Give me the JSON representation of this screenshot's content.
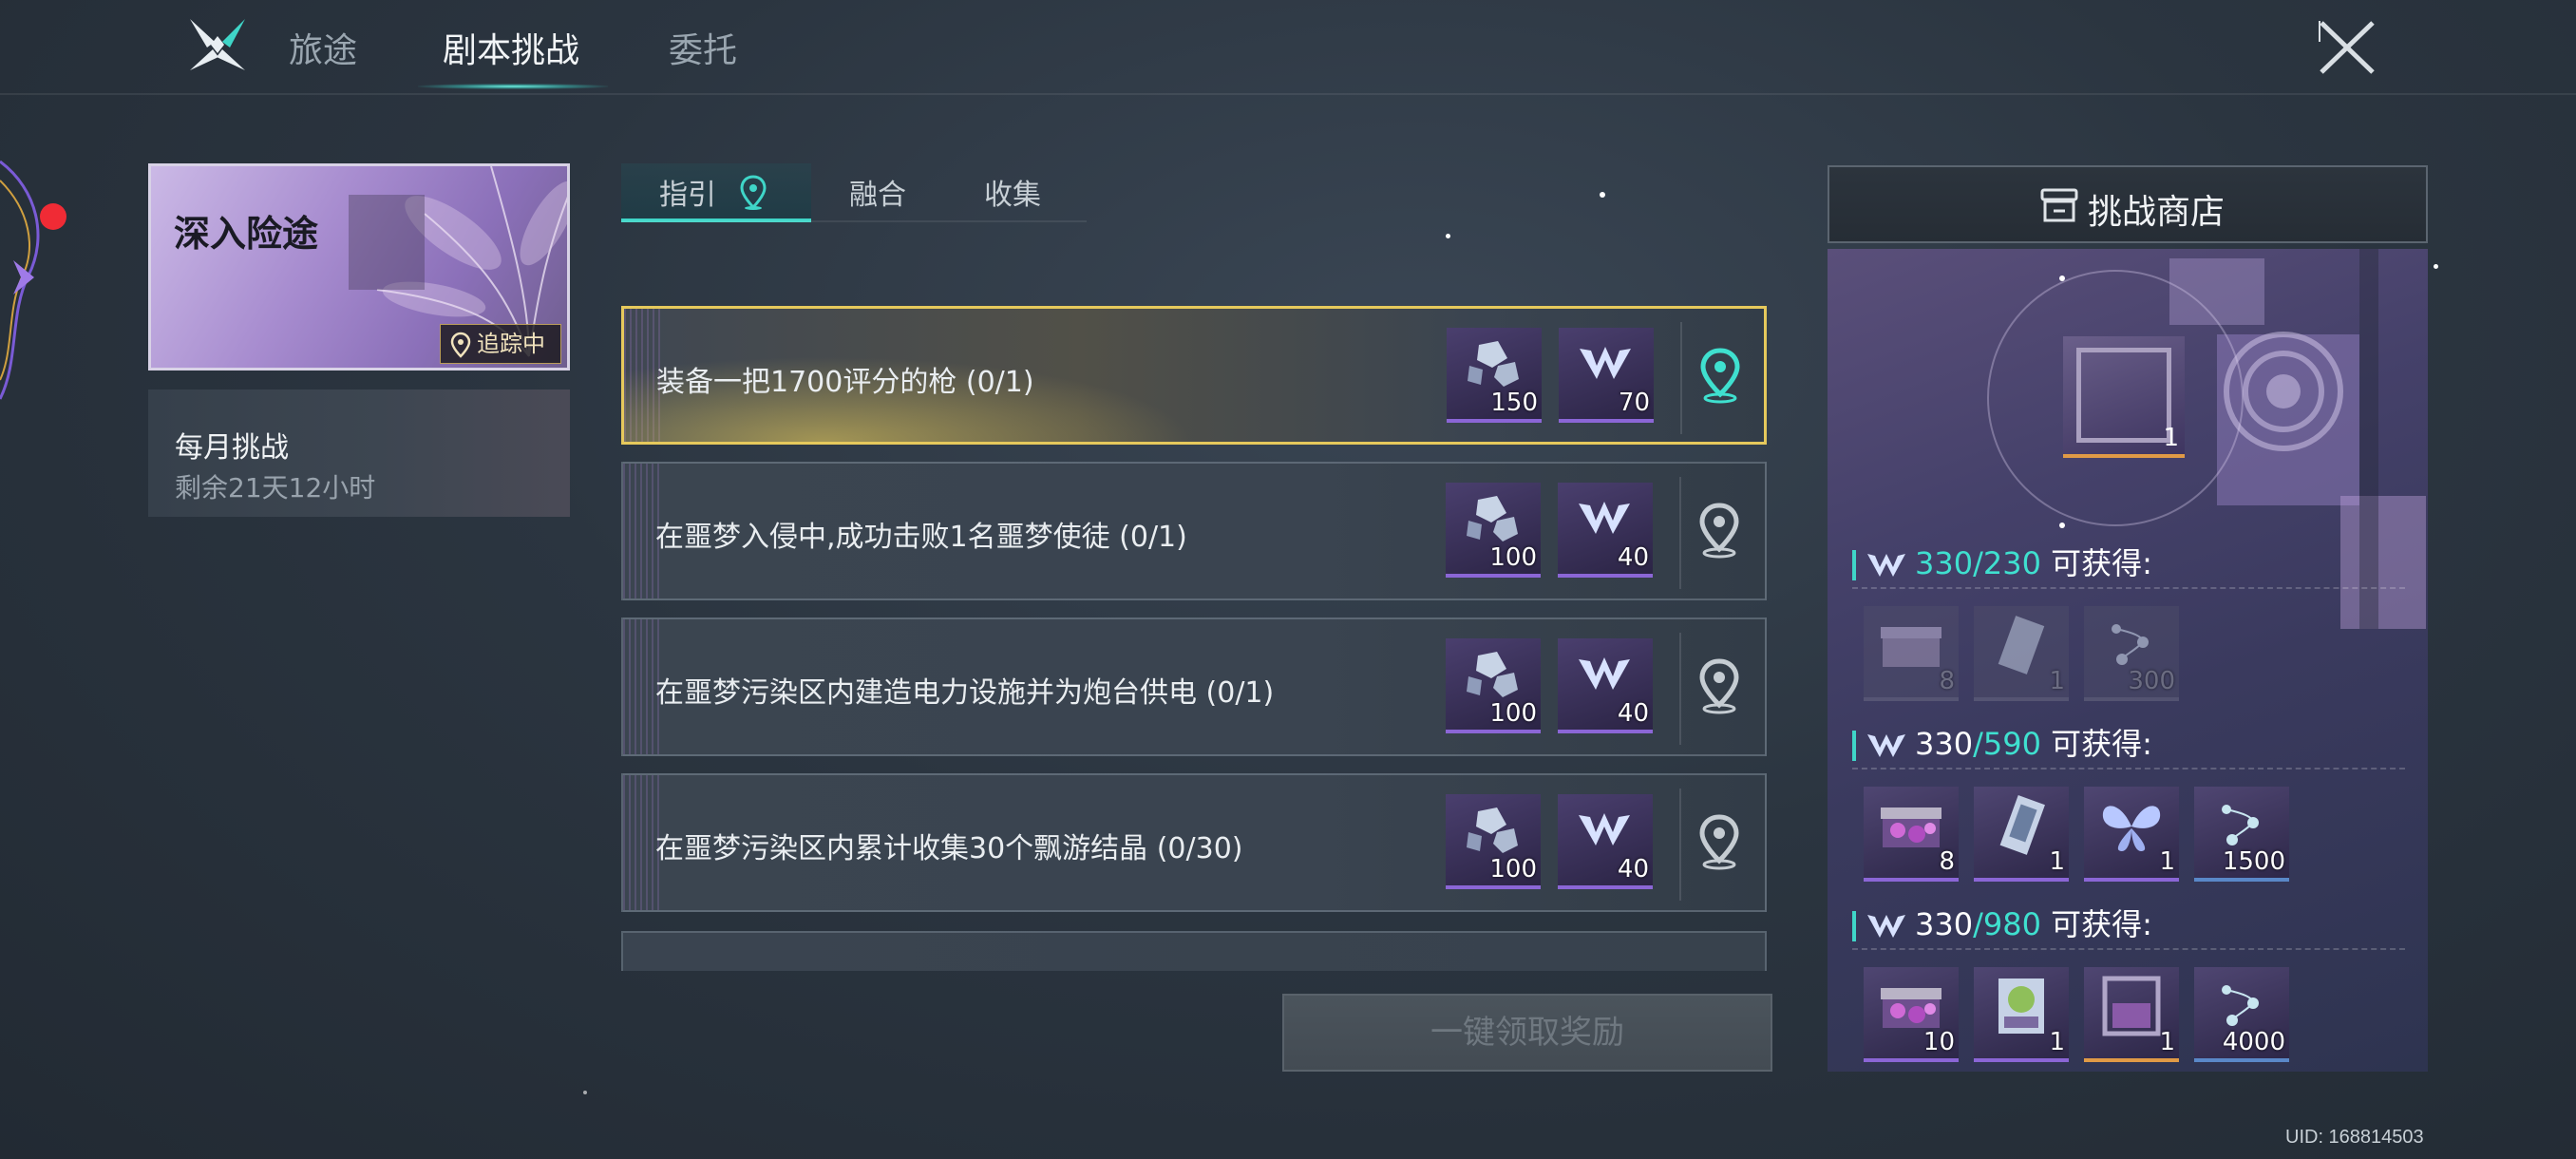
{
  "top_tabs": [
    {
      "label": "旅途"
    },
    {
      "label": "剧本挑战"
    },
    {
      "label": "委托"
    }
  ],
  "left_panel": {
    "deep_card": {
      "title": "深入险途",
      "badge": "追踪中"
    },
    "monthly_card": {
      "title": "每月挑战",
      "remaining": "剩余21天12小时"
    }
  },
  "sub_tabs": [
    {
      "label": "指引"
    },
    {
      "label": "融合"
    },
    {
      "label": "收集"
    }
  ],
  "quests": [
    {
      "text": "装备一把1700评分的枪 (0/1)",
      "reward_crystal": "150",
      "reward_token": "70",
      "tracked": true
    },
    {
      "text": "在噩梦入侵中,成功击败1名噩梦使徒 (0/1)",
      "reward_crystal": "100",
      "reward_token": "40",
      "tracked": false
    },
    {
      "text": "在噩梦污染区内建造电力设施并为炮台供电 (0/1)",
      "reward_crystal": "100",
      "reward_token": "40",
      "tracked": false
    },
    {
      "text": "在噩梦污染区内累计收集30个飘游结晶 (0/30)",
      "reward_crystal": "100",
      "reward_token": "40",
      "tracked": false
    }
  ],
  "claim_button": "一键领取奖励",
  "shop": {
    "title": "挑战商店",
    "featured_count": "1",
    "tiers": [
      {
        "current": "330",
        "goal": "/230",
        "label": "可获得:",
        "items": [
          {
            "icon": "chest-icon",
            "count": "8"
          },
          {
            "icon": "card-icon",
            "count": "1"
          },
          {
            "icon": "fragments-icon",
            "count": "300"
          }
        ]
      },
      {
        "current": "330",
        "goal": "/590",
        "label": "可获得:",
        "items": [
          {
            "icon": "chest-icon",
            "count": "8"
          },
          {
            "icon": "card-icon",
            "count": "1"
          },
          {
            "icon": "butterfly-icon",
            "count": "1"
          },
          {
            "icon": "fragments-icon",
            "count": "1500"
          }
        ]
      },
      {
        "current": "330",
        "goal": "/980",
        "label": "可获得:",
        "items": [
          {
            "icon": "chest-icon",
            "count": "10"
          },
          {
            "icon": "orb-card-icon",
            "count": "1"
          },
          {
            "icon": "frame-icon",
            "count": "1"
          },
          {
            "icon": "fragments-icon",
            "count": "4000"
          }
        ]
      }
    ]
  },
  "uid": "UID: 168814503",
  "colors": {
    "accent": "#3fd6c8",
    "highlight": "#e6c95c",
    "alert": "#f02b35"
  }
}
